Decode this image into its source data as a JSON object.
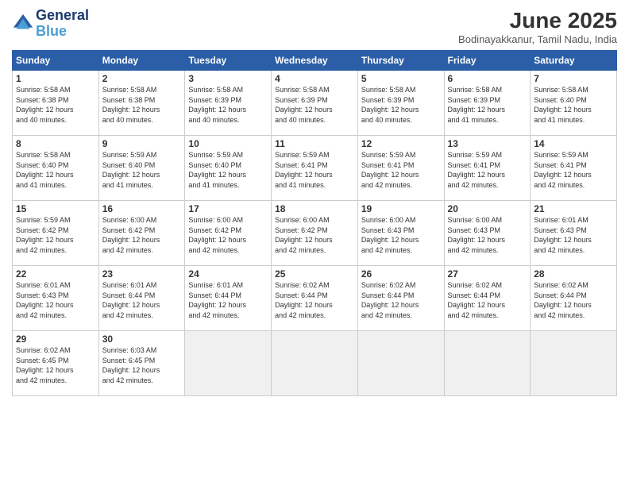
{
  "logo": {
    "line1": "General",
    "line2": "Blue"
  },
  "title": "June 2025",
  "subtitle": "Bodinayakkanur, Tamil Nadu, India",
  "headers": [
    "Sunday",
    "Monday",
    "Tuesday",
    "Wednesday",
    "Thursday",
    "Friday",
    "Saturday"
  ],
  "weeks": [
    [
      {
        "day": "1",
        "info": "Sunrise: 5:58 AM\nSunset: 6:38 PM\nDaylight: 12 hours\nand 40 minutes."
      },
      {
        "day": "2",
        "info": "Sunrise: 5:58 AM\nSunset: 6:38 PM\nDaylight: 12 hours\nand 40 minutes."
      },
      {
        "day": "3",
        "info": "Sunrise: 5:58 AM\nSunset: 6:39 PM\nDaylight: 12 hours\nand 40 minutes."
      },
      {
        "day": "4",
        "info": "Sunrise: 5:58 AM\nSunset: 6:39 PM\nDaylight: 12 hours\nand 40 minutes."
      },
      {
        "day": "5",
        "info": "Sunrise: 5:58 AM\nSunset: 6:39 PM\nDaylight: 12 hours\nand 40 minutes."
      },
      {
        "day": "6",
        "info": "Sunrise: 5:58 AM\nSunset: 6:39 PM\nDaylight: 12 hours\nand 41 minutes."
      },
      {
        "day": "7",
        "info": "Sunrise: 5:58 AM\nSunset: 6:40 PM\nDaylight: 12 hours\nand 41 minutes."
      }
    ],
    [
      {
        "day": "8",
        "info": "Sunrise: 5:58 AM\nSunset: 6:40 PM\nDaylight: 12 hours\nand 41 minutes."
      },
      {
        "day": "9",
        "info": "Sunrise: 5:59 AM\nSunset: 6:40 PM\nDaylight: 12 hours\nand 41 minutes."
      },
      {
        "day": "10",
        "info": "Sunrise: 5:59 AM\nSunset: 6:40 PM\nDaylight: 12 hours\nand 41 minutes."
      },
      {
        "day": "11",
        "info": "Sunrise: 5:59 AM\nSunset: 6:41 PM\nDaylight: 12 hours\nand 41 minutes."
      },
      {
        "day": "12",
        "info": "Sunrise: 5:59 AM\nSunset: 6:41 PM\nDaylight: 12 hours\nand 42 minutes."
      },
      {
        "day": "13",
        "info": "Sunrise: 5:59 AM\nSunset: 6:41 PM\nDaylight: 12 hours\nand 42 minutes."
      },
      {
        "day": "14",
        "info": "Sunrise: 5:59 AM\nSunset: 6:41 PM\nDaylight: 12 hours\nand 42 minutes."
      }
    ],
    [
      {
        "day": "15",
        "info": "Sunrise: 5:59 AM\nSunset: 6:42 PM\nDaylight: 12 hours\nand 42 minutes."
      },
      {
        "day": "16",
        "info": "Sunrise: 6:00 AM\nSunset: 6:42 PM\nDaylight: 12 hours\nand 42 minutes."
      },
      {
        "day": "17",
        "info": "Sunrise: 6:00 AM\nSunset: 6:42 PM\nDaylight: 12 hours\nand 42 minutes."
      },
      {
        "day": "18",
        "info": "Sunrise: 6:00 AM\nSunset: 6:42 PM\nDaylight: 12 hours\nand 42 minutes."
      },
      {
        "day": "19",
        "info": "Sunrise: 6:00 AM\nSunset: 6:43 PM\nDaylight: 12 hours\nand 42 minutes."
      },
      {
        "day": "20",
        "info": "Sunrise: 6:00 AM\nSunset: 6:43 PM\nDaylight: 12 hours\nand 42 minutes."
      },
      {
        "day": "21",
        "info": "Sunrise: 6:01 AM\nSunset: 6:43 PM\nDaylight: 12 hours\nand 42 minutes."
      }
    ],
    [
      {
        "day": "22",
        "info": "Sunrise: 6:01 AM\nSunset: 6:43 PM\nDaylight: 12 hours\nand 42 minutes."
      },
      {
        "day": "23",
        "info": "Sunrise: 6:01 AM\nSunset: 6:44 PM\nDaylight: 12 hours\nand 42 minutes."
      },
      {
        "day": "24",
        "info": "Sunrise: 6:01 AM\nSunset: 6:44 PM\nDaylight: 12 hours\nand 42 minutes."
      },
      {
        "day": "25",
        "info": "Sunrise: 6:02 AM\nSunset: 6:44 PM\nDaylight: 12 hours\nand 42 minutes."
      },
      {
        "day": "26",
        "info": "Sunrise: 6:02 AM\nSunset: 6:44 PM\nDaylight: 12 hours\nand 42 minutes."
      },
      {
        "day": "27",
        "info": "Sunrise: 6:02 AM\nSunset: 6:44 PM\nDaylight: 12 hours\nand 42 minutes."
      },
      {
        "day": "28",
        "info": "Sunrise: 6:02 AM\nSunset: 6:44 PM\nDaylight: 12 hours\nand 42 minutes."
      }
    ],
    [
      {
        "day": "29",
        "info": "Sunrise: 6:02 AM\nSunset: 6:45 PM\nDaylight: 12 hours\nand 42 minutes."
      },
      {
        "day": "30",
        "info": "Sunrise: 6:03 AM\nSunset: 6:45 PM\nDaylight: 12 hours\nand 42 minutes."
      },
      {
        "day": "",
        "info": ""
      },
      {
        "day": "",
        "info": ""
      },
      {
        "day": "",
        "info": ""
      },
      {
        "day": "",
        "info": ""
      },
      {
        "day": "",
        "info": ""
      }
    ]
  ]
}
